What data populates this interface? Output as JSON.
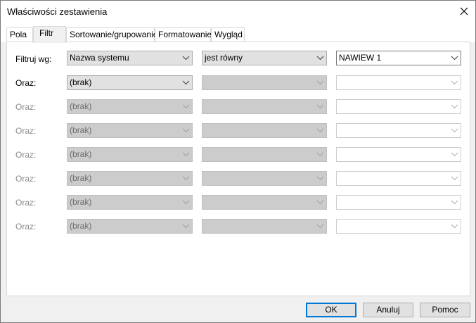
{
  "window": {
    "title": "Właściwości zestawienia"
  },
  "tabs": [
    {
      "label": "Pola",
      "active": false
    },
    {
      "label": "Filtr",
      "active": true
    },
    {
      "label": "Sortowanie/grupowanie",
      "active": false
    },
    {
      "label": "Formatowanie",
      "active": false
    },
    {
      "label": "Wygląd",
      "active": false
    }
  ],
  "filter": {
    "rows": [
      {
        "label": "Filtruj wg:",
        "field": "Nazwa systemu",
        "operator": "jest równy",
        "value": "NAWIEW 1",
        "state": "active"
      },
      {
        "label": "Oraz:",
        "field": "(brak)",
        "operator": "",
        "value": "",
        "state": "partial"
      },
      {
        "label": "Oraz:",
        "field": "(brak)",
        "operator": "",
        "value": "",
        "state": "disabled"
      },
      {
        "label": "Oraz:",
        "field": "(brak)",
        "operator": "",
        "value": "",
        "state": "disabled"
      },
      {
        "label": "Oraz:",
        "field": "(brak)",
        "operator": "",
        "value": "",
        "state": "disabled"
      },
      {
        "label": "Oraz:",
        "field": "(brak)",
        "operator": "",
        "value": "",
        "state": "disabled"
      },
      {
        "label": "Oraz:",
        "field": "(brak)",
        "operator": "",
        "value": "",
        "state": "disabled"
      },
      {
        "label": "Oraz:",
        "field": "(brak)",
        "operator": "",
        "value": "",
        "state": "disabled"
      }
    ]
  },
  "buttons": {
    "ok": "OK",
    "cancel": "Anuluj",
    "help": "Pomoc"
  },
  "icons": {
    "close": "close-icon",
    "dropdown": "chevron-down-icon"
  },
  "colors": {
    "default_button_border": "#0078d7",
    "disabled_combo": "#cccccc",
    "enabled_combo": "#e1e1e1"
  }
}
